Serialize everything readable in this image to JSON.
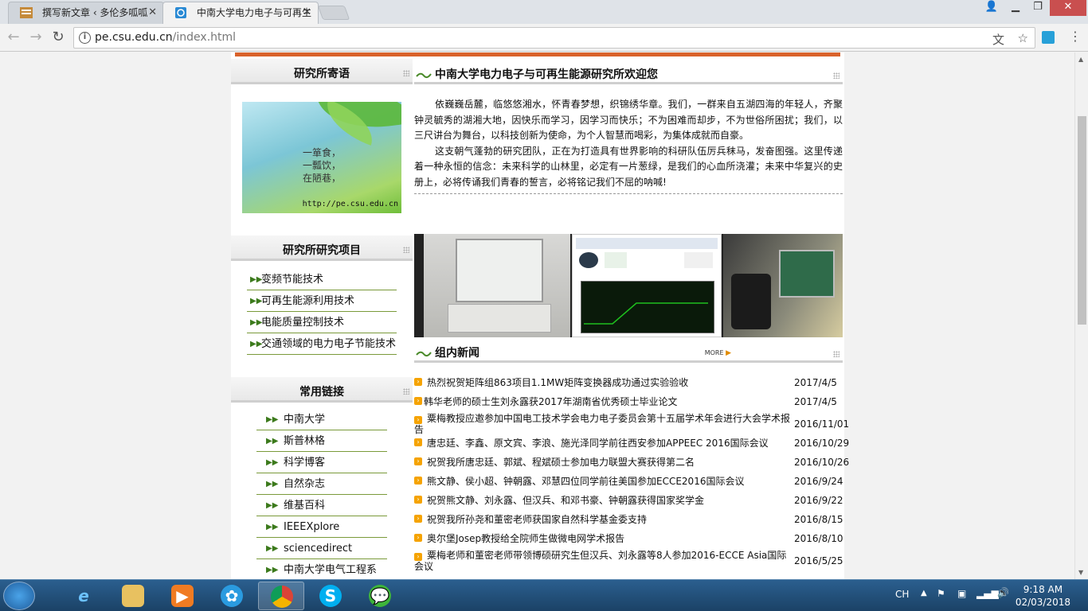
{
  "browser": {
    "tabs": [
      {
        "title": "撰写新文章 ‹ 多伦多呱呱"
      },
      {
        "title": "中南大学电力电子与可再生"
      }
    ],
    "url_host": "pe.csu.edu.cn",
    "url_path": "/index.html"
  },
  "left": {
    "message_title": "研究所寄语",
    "slogan_lines": [
      "一箪食，",
      "一瓢饮，",
      "在陋巷，"
    ],
    "slogan_site": "http://pe.csu.edu.cn",
    "projects_title": "研究所研究项目",
    "projects": [
      {
        "label": "变频节能技术"
      },
      {
        "label": "可再生能源利用技术"
      },
      {
        "label": "电能质量控制技术"
      },
      {
        "label": "交通领域的电力电子节能技术"
      }
    ],
    "links_title": "常用链接",
    "links": [
      {
        "label": "中南大学"
      },
      {
        "label": "斯普林格"
      },
      {
        "label": "科学博客"
      },
      {
        "label": "自然杂志"
      },
      {
        "label": "维基百科"
      },
      {
        "label": "IEEEXplore"
      },
      {
        "label": "sciencedirect"
      },
      {
        "label": "中南大学电气工程系"
      }
    ]
  },
  "welcome": {
    "title": "中南大学电力电子与可再生能源研究所欢迎您",
    "para1": "依巍巍岳麓，临悠悠湘水，怀青春梦想，织锦绣华章。我们，一群来自五湖四海的年轻人，齐聚钟灵毓秀的湖湘大地，因快乐而学习，因学习而快乐；不为困难而却步，不为世俗所困扰；我们，以三尺讲台为舞台，以科技创新为使命，为个人智慧而喝彩，为集体成就而自豪。",
    "para2": "这支朝气蓬勃的研究团队，正在为打造具有世界影响的科研队伍厉兵秣马，发奋图强。这里传递着一种永恒的信念：未来科学的山林里，必定有一片葱绿，是我们的心血所浇灌；未来中华复兴的史册上，必将传诵我们青春的誓言，必将铭记我们不屈的呐喊!"
  },
  "news": {
    "title": "组内新闻",
    "more": "MORE",
    "items": [
      {
        "title": "热烈祝贺矩阵组863项目1.1MW矩阵变换器成功通过实验验收",
        "date": "2017/4/5"
      },
      {
        "title": "韩华老师的硕士生刘永露获2017年湖南省优秀硕士毕业论文",
        "date": "2017/4/5"
      },
      {
        "title": "粟梅教授应邀参加中国电工技术学会电力电子委员会第十五届学术年会进行大会学术报告",
        "date": "2016/11/01"
      },
      {
        "title": "唐忠廷、李鑫、原文宾、李浪、施光泽同学前往西安参加APPEEC 2016国际会议",
        "date": "2016/10/29"
      },
      {
        "title": "祝贺我所唐忠廷、郭斌、程斌硕士参加电力联盟大赛获得第二名",
        "date": "2016/10/26"
      },
      {
        "title": "熊文静、侯小超、钟朝露、邓慧四位同学前往美国参加ECCE2016国际会议",
        "date": "2016/9/24"
      },
      {
        "title": "祝贺熊文静、刘永露、但汉兵、和邓书豪、钟朝露获得国家奖学金",
        "date": "2016/9/22"
      },
      {
        "title": "祝贺我所孙尧和董密老师获国家自然科学基金委支持",
        "date": "2016/8/15"
      },
      {
        "title": "奥尔堡Josep教授给全院师生做微电网学术报告",
        "date": "2016/8/10"
      },
      {
        "title": "粟梅老师和董密老师带领博硕研究生但汉兵、刘永露等8人参加2016-ECCE Asia国际会议",
        "date": "2016/5/25"
      }
    ]
  },
  "taskbar": {
    "lang": "CH",
    "time": "9:18 AM",
    "date": "02/03/2018"
  },
  "colors": {
    "accent_bar": "#d9622b",
    "link_green": "#3c7a1c",
    "news_bullet": "#f5a300"
  }
}
